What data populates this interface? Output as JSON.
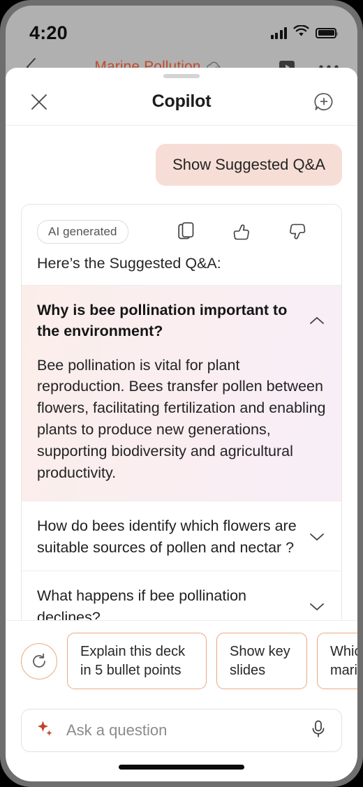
{
  "status_bar": {
    "time": "4:20",
    "signal_icon": "cellular-signal-icon",
    "wifi_icon": "wifi-icon",
    "battery_icon": "battery-full-icon"
  },
  "background_app": {
    "back_icon": "back-chevron-icon",
    "title": "Marine Pollution",
    "cloud_icon": "cloud-sync-icon",
    "present_icon": "present-icon",
    "more_icon": "more-options-icon",
    "title_color": "#bf4b2b"
  },
  "sheet": {
    "close_label": "×",
    "title": "Copilot",
    "new_chat_icon": "new-chat-bubble-plus-icon"
  },
  "conversation": {
    "user_message": "Show Suggested Q&A",
    "user_bubble_color": "#f6ded6",
    "response": {
      "badge": "AI generated",
      "actions": [
        {
          "name": "copy-icon",
          "label": "Copy"
        },
        {
          "name": "thumbs-up-icon",
          "label": "Like"
        },
        {
          "name": "thumbs-down-icon",
          "label": "Dislike"
        }
      ],
      "intro": "Here’s the Suggested Q&A:",
      "qa_items": [
        {
          "question": "Why is bee pollination important to the environment?",
          "answer": "Bee pollination is vital for plant reproduction. Bees transfer pollen between flowers, facilitating fertilization and enabling plants to produce new generations, supporting biodiversity and agricultural productivity.",
          "expanded": true,
          "chevron": "chevron-up-icon"
        },
        {
          "question": "How do bees identify which flowers are suitable sources of pollen and nectar ?",
          "answer": "",
          "expanded": false,
          "chevron": "chevron-down-icon"
        },
        {
          "question": "What happens if bee pollination declines?",
          "answer": "",
          "expanded": false,
          "chevron": "chevron-down-icon"
        }
      ]
    }
  },
  "suggestions": {
    "refresh_icon": "refresh-icon",
    "chips": [
      "Explain this deck in 5 bullet points",
      "Show key slides",
      "Which marine"
    ],
    "border_color": "#eaa882"
  },
  "composer": {
    "sparkle_icon": "copilot-sparkle-icon",
    "placeholder": "Ask a question",
    "value": "",
    "mic_icon": "microphone-icon",
    "sparkle_color": "#c0452a"
  }
}
